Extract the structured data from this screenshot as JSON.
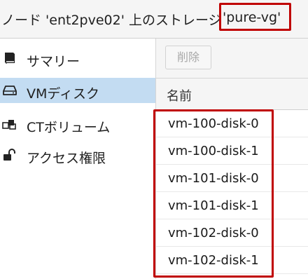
{
  "header": {
    "title_prefix": "ノード 'ent2pve02' 上のストレージ",
    "storage_name": "'pure-vg'"
  },
  "sidebar": {
    "items": [
      {
        "label": "サマリー",
        "icon": "book-icon",
        "selected": false
      },
      {
        "label": "VMディスク",
        "icon": "hdd-icon",
        "selected": true
      },
      {
        "label": "CTボリューム",
        "icon": "cubes-icon",
        "selected": false
      },
      {
        "label": "アクセス権限",
        "icon": "unlock-icon",
        "selected": false
      }
    ]
  },
  "toolbar": {
    "delete_label": "削除"
  },
  "table": {
    "column_header": "名前",
    "rows": [
      "vm-100-disk-0",
      "vm-100-disk-1",
      "vm-101-disk-0",
      "vm-101-disk-1",
      "vm-102-disk-0",
      "vm-102-disk-1"
    ]
  },
  "colors": {
    "highlight": "#c00000",
    "selected_bg": "#c3dcf2"
  }
}
